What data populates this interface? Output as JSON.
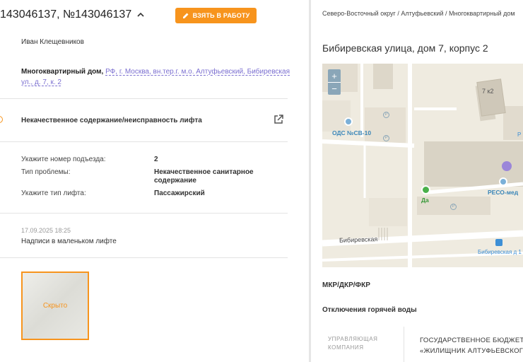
{
  "header": {
    "tickets": "143046137, №143046137",
    "take_button": "ВЗЯТЬ В РАБОТУ"
  },
  "author": "Иван Клещевников",
  "address": {
    "type": "Многоквартирный дом,",
    "link": "РФ, г. Москва, вн.тер.г. м.о. Алтуфьевский, Бибиревская ул., д. 7, к. 2"
  },
  "problem": {
    "title": "Некачественное содержание/неисправность лифта"
  },
  "details": [
    {
      "label": "Укажите номер подъезда:",
      "value": "2"
    },
    {
      "label": "Тип проблемы:",
      "value": "Некачественное санитарное содержание"
    },
    {
      "label": "Укажите тип лифта:",
      "value": "Пассажирский"
    }
  ],
  "comment": {
    "date": "17.09.2025 18:25",
    "text": "Надписи в маленьком лифте"
  },
  "attachment": {
    "label": "Скрыто"
  },
  "right": {
    "breadcrumb": "Северо-Восточный округ / Алтуфьевский / Многоквартирный дом",
    "title": "Бибиревская улица, дом 7, корпус 2",
    "map": {
      "zoom_in": "+",
      "zoom_out": "−",
      "building_label": "7 к2",
      "ods_label": "ОДС №СВ-10",
      "reso_label": "РЕСО-мед",
      "shop_label": "Да",
      "street_label": "Бибиревская",
      "stop_label": "Бибиревская д 1",
      "edge_label": "Р",
      "parking": "P",
      "colors": {
        "water": "#7bb0d8",
        "poi": "#9b86d9",
        "shop": "#4ab04a",
        "bus": "#3d8fd6"
      }
    },
    "section1": "МКР/ДКР/ФКР",
    "section2": "Отключения горячей воды",
    "mgmt_label": "УПРАВЛЯЮЩАЯ КОМПАНИЯ",
    "mgmt_value_line1": "ГОСУДАРСТВЕННОЕ БЮДЖЕТН",
    "mgmt_value_line2": "«ЖИЛИЩНИК АЛТУФЬЕВСКОГО"
  },
  "accent_color": "#f7941d",
  "link_color": "#7b6fd0"
}
